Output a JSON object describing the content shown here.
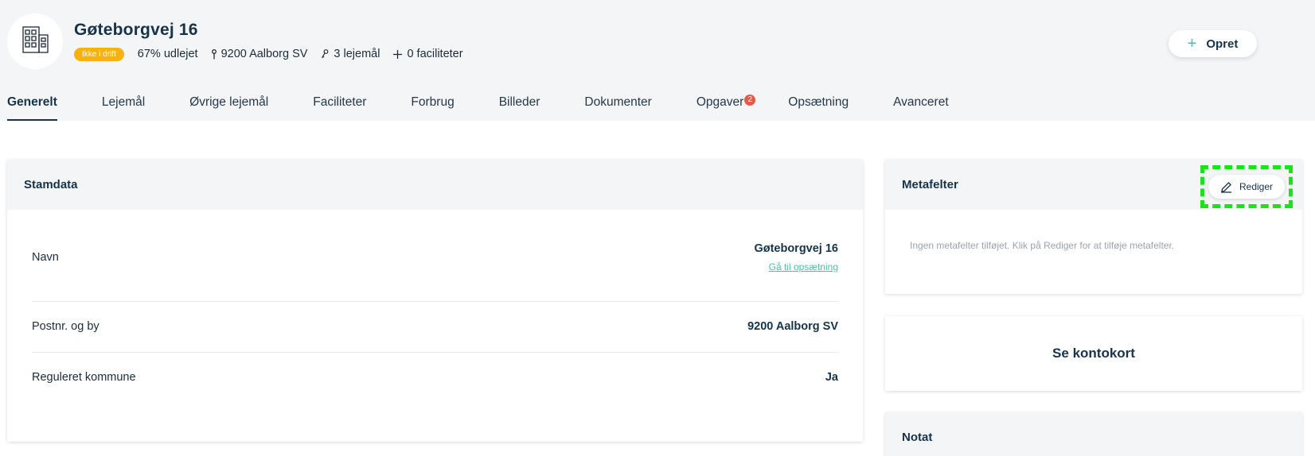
{
  "header": {
    "title": "Gøteborgvej 16",
    "status_badge": "Ikke i drift",
    "occupancy": "67% udlejet",
    "location": "9200 Aalborg SV",
    "leases": "3 lejemål",
    "facilities": "0 faciliteter",
    "create_button": "Opret",
    "colors": {
      "badge": "#f7b20c",
      "accent": "#48c0a8",
      "notification": "#e4594a"
    }
  },
  "tabs": [
    {
      "label": "Generelt",
      "active": true
    },
    {
      "label": "Lejemål"
    },
    {
      "label": "Øvrige lejemål"
    },
    {
      "label": "Faciliteter"
    },
    {
      "label": "Forbrug"
    },
    {
      "label": "Billeder"
    },
    {
      "label": "Dokumenter"
    },
    {
      "label": "Opgaver",
      "count": "2"
    },
    {
      "label": "Opsætning"
    },
    {
      "label": "Avanceret"
    }
  ],
  "stamdata": {
    "title": "Stamdata",
    "rows": [
      {
        "label": "Navn",
        "value": "Gøteborgvej 16",
        "link": "Gå til opsætning"
      },
      {
        "label": "Postnr. og by",
        "value": "9200 Aalborg SV"
      },
      {
        "label": "Reguleret kommune",
        "value": "Ja"
      }
    ]
  },
  "metafelter": {
    "title": "Metafelter",
    "edit_button": "Rediger",
    "empty_text": "Ingen metafelter tilføjet. Klik på Rediger for at tilføje metafelter."
  },
  "kontokort": {
    "label": "Se kontokort"
  },
  "notat": {
    "title": "Notat"
  },
  "icons": {
    "avatar": "building-icon",
    "location": "pin-icon",
    "leases": "key-icon",
    "facilities": "plus-icon",
    "create": "plus-icon",
    "edit": "pencil-icon"
  }
}
